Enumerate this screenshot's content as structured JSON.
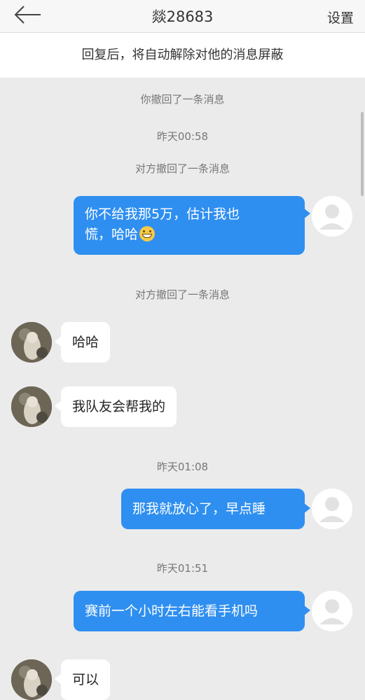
{
  "header": {
    "title": "燚28683",
    "settings_label": "设置",
    "back_icon": "back-arrow-icon"
  },
  "notice": {
    "text": "回复后，将自动解除对他的消息屏蔽"
  },
  "messages": {
    "sys_1": "你撤回了一条消息",
    "time_1": "昨天00:58",
    "sys_2": "对方撤回了一条消息",
    "out_1_line1": "你不给我那5万，估计我也",
    "out_1_line2": "慌，哈哈",
    "sys_3": "对方撤回了一条消息",
    "in_1": "哈哈",
    "in_2": "我队友会帮我的",
    "time_2": "昨天01:08",
    "out_2": "那我就放心了，早点睡",
    "time_3": "昨天01:51",
    "out_3": "赛前一个小时左右能看手机吗",
    "in_3": "可以"
  },
  "colors": {
    "accent_bubble": "#2f8ff0",
    "background": "#ebebeb",
    "incoming_bubble": "#ffffff"
  },
  "icons": {
    "emoji": "grinning-face-icon",
    "my_avatar": "default-user-avatar-icon",
    "other_avatar": "cat-photo-avatar"
  }
}
